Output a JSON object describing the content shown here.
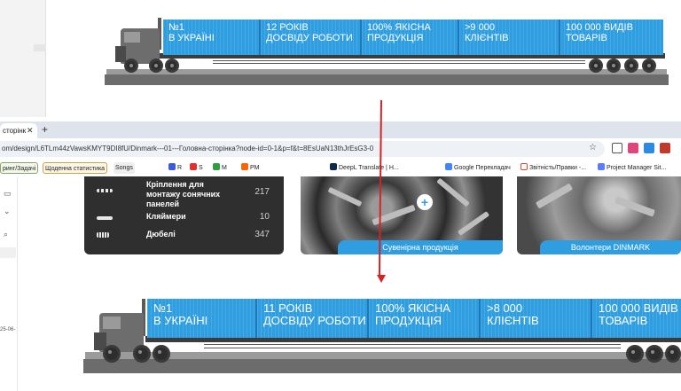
{
  "top_banner": {
    "containers": [
      {
        "line1": "№1",
        "line2": "В УКРАЇНІ"
      },
      {
        "line1": "12 РОКІВ",
        "line2": "ДОСВІДУ РОБОТИ"
      },
      {
        "line1": "100% ЯКІСНА",
        "line2": "ПРОДУКЦІЯ"
      },
      {
        "line1": ">9 000",
        "line2": "КЛІЄНТІВ"
      },
      {
        "line1": "100 000 ВИДІВ",
        "line2": "ТОВАРІВ"
      }
    ]
  },
  "browser": {
    "tab_title": "сторінк",
    "tab_close": "✕",
    "new_tab": "+",
    "url": "om/design/L6TLm44zVawsKMYT9DI8fU/Dinmark---01---Головна-сторінка?node-id=0-1&p=f&t=8EsUaN13thJrEsG3-0",
    "star": "☆",
    "bookmarks": [
      {
        "label": "ринг/Задачі"
      },
      {
        "label": "Щоденна статистика"
      },
      {
        "label": "Songs"
      },
      {
        "label": "R"
      },
      {
        "label": "S"
      },
      {
        "label": "M"
      },
      {
        "label": "PM"
      },
      {
        "label": "DeepL Translate | Н..."
      },
      {
        "label": "Google Перекладач"
      },
      {
        "label": "Звітність/Правки -..."
      },
      {
        "label": "Project Manager Sit..."
      }
    ]
  },
  "sidebar": {
    "date": "25-06-"
  },
  "dark_list": {
    "items": [
      {
        "name": "Кріплення для монтажу сонячних панелей",
        "count": "217"
      },
      {
        "name": "Кляймери",
        "count": "10"
      },
      {
        "name": "Дюбелі",
        "count": "347"
      }
    ]
  },
  "photo_cards": {
    "left_caption": "Сувенірна продукція",
    "right_caption": "Волонтери DINMARK",
    "plus": "+"
  },
  "bottom_banner": {
    "containers": [
      {
        "line1": "№1",
        "line2": "В УКРАЇНІ"
      },
      {
        "line1": "11 РОКІВ",
        "line2": "ДОСВІДУ РОБОТИ"
      },
      {
        "line1": "100% ЯКІСНА",
        "line2": "ПРОДУКЦІЯ"
      },
      {
        "line1": ">8 000",
        "line2": "КЛІЄНТІВ"
      },
      {
        "line1": "100 000 ВИДІВ",
        "line2": "ТОВАРІВ"
      }
    ]
  },
  "colors": {
    "container_blue": "#2f9ee0",
    "arrow_red": "#d32424",
    "dark_card": "#2f2f2f"
  }
}
